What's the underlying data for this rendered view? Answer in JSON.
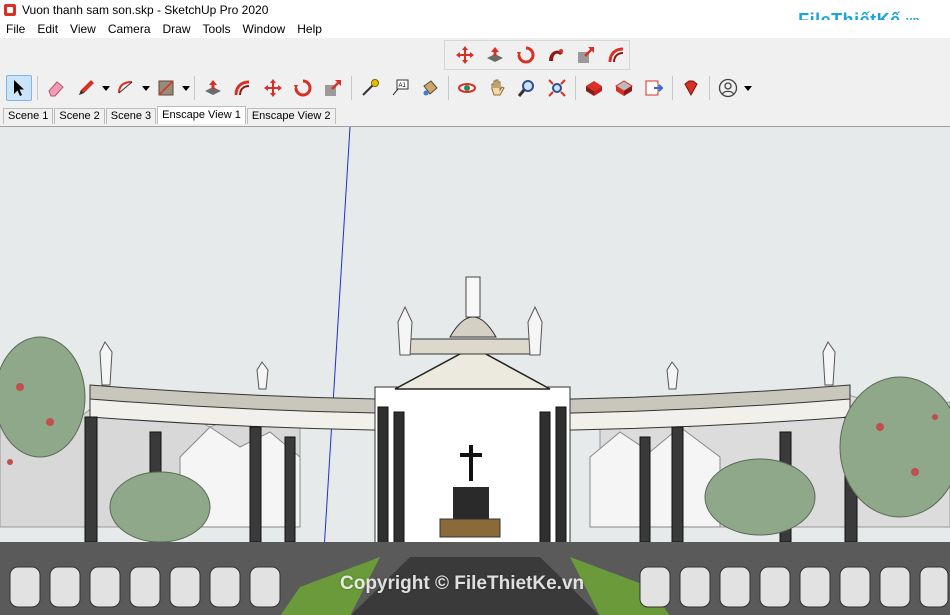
{
  "window": {
    "title": "Vuon thanh sam son.skp - SketchUp Pro 2020"
  },
  "watermark": {
    "brand_main": "FileThiếtKế",
    "brand_suffix": ".vn",
    "copyright": "Copyright © FileThietKe.vn"
  },
  "menu": {
    "items": [
      "File",
      "Edit",
      "View",
      "Camera",
      "Draw",
      "Tools",
      "Window",
      "Help"
    ]
  },
  "toolbar_top": {
    "icons": [
      "move-icon",
      "push-pull-icon",
      "rotate-icon",
      "follow-me-icon",
      "scale-icon",
      "offset-icon"
    ]
  },
  "toolbar_main": {
    "icons": [
      "select-icon",
      "eraser-icon",
      "pencil-icon",
      "arc-icon",
      "rectangle-icon",
      "push-pull-icon",
      "offset-icon",
      "move-icon",
      "rotate-icon",
      "scale-icon",
      "tape-measure-icon",
      "text-icon",
      "paint-bucket-icon",
      "orbit-icon",
      "pan-icon",
      "zoom-icon",
      "zoom-extents-icon",
      "warehouse-icon",
      "extension-warehouse-icon",
      "send-to-layout-icon",
      "ruby-icon",
      "account-icon"
    ]
  },
  "scenes": {
    "tabs": [
      "Scene 1",
      "Scene 2",
      "Scene 3",
      "Enscape View 1",
      "Enscape View 2"
    ],
    "active_index": 3
  },
  "colors": {
    "accent_red": "#d93025",
    "selection_blue": "#cce4f7",
    "brand_blue": "#1ba3dc",
    "axis_blue": "#1f2fd6"
  }
}
